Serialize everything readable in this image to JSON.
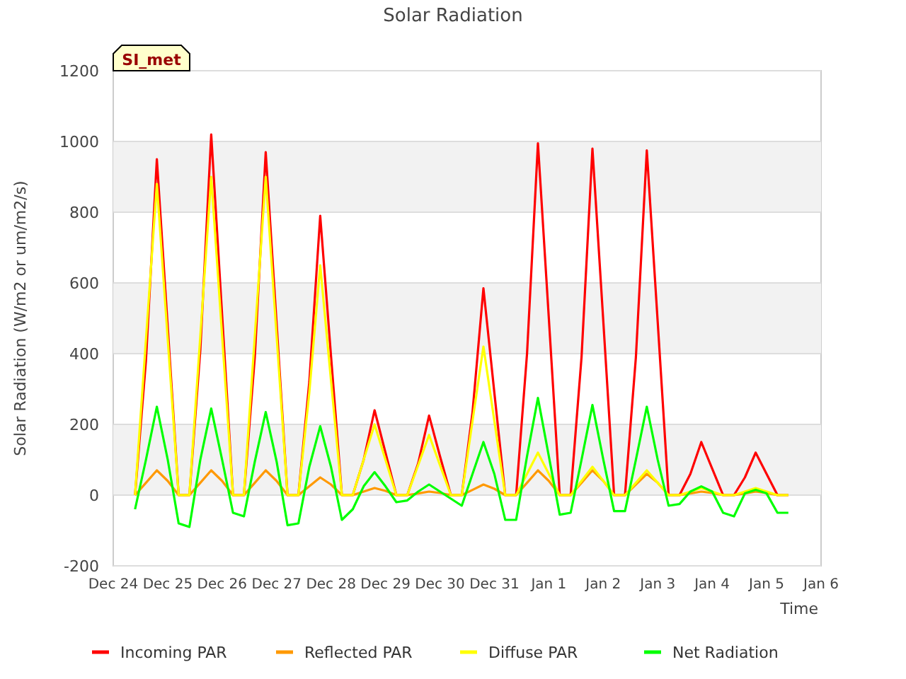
{
  "site_label": "SI_met",
  "chart_data": {
    "type": "line",
    "title": "Solar Radiation",
    "xlabel": "Time",
    "ylabel": "Solar Radiation (W/m2 or um/m2/s)",
    "categories": [
      "Dec 24",
      null,
      null,
      null,
      null,
      "Dec 25",
      null,
      null,
      null,
      null,
      "Dec 26",
      null,
      null,
      null,
      null,
      "Dec 27",
      null,
      null,
      null,
      null,
      "Dec 28",
      null,
      null,
      null,
      null,
      "Dec 29",
      null,
      null,
      null,
      null,
      "Dec 30",
      null,
      null,
      null,
      null,
      "Dec 31",
      null,
      null,
      null,
      null,
      "Jan 1",
      null,
      null,
      null,
      null,
      "Jan 2",
      null,
      null,
      null,
      null,
      "Jan 3",
      null,
      null,
      null,
      null,
      "Jan 4",
      null,
      null,
      null,
      null,
      "Jan 5",
      null,
      null,
      null,
      null,
      "Jan 6"
    ],
    "series": [
      {
        "name": "Incoming PAR",
        "color": "#ff0000",
        "values": [
          null,
          null,
          0,
          380,
          950,
          475,
          0,
          0,
          410,
          1020,
          510,
          0,
          0,
          390,
          970,
          485,
          0,
          0,
          320,
          790,
          395,
          0,
          0,
          100,
          240,
          120,
          0,
          0,
          90,
          225,
          110,
          0,
          0,
          235,
          585,
          290,
          0,
          0,
          400,
          995,
          500,
          0,
          0,
          390,
          980,
          490,
          0,
          0,
          390,
          975,
          490,
          0,
          0,
          60,
          150,
          75,
          0,
          0,
          50,
          120,
          60,
          0,
          0,
          null,
          null,
          null
        ]
      },
      {
        "name": "Reflected PAR",
        "color": "#ff9900",
        "values": [
          null,
          null,
          0,
          35,
          70,
          40,
          0,
          0,
          35,
          70,
          40,
          0,
          0,
          35,
          70,
          40,
          0,
          0,
          25,
          50,
          30,
          0,
          0,
          10,
          20,
          12,
          0,
          0,
          5,
          10,
          6,
          0,
          0,
          15,
          30,
          18,
          0,
          0,
          35,
          70,
          40,
          0,
          0,
          35,
          70,
          40,
          0,
          0,
          30,
          60,
          35,
          0,
          0,
          5,
          10,
          6,
          0,
          0,
          5,
          10,
          6,
          0,
          0,
          null,
          null,
          null
        ]
      },
      {
        "name": "Diffuse PAR",
        "color": "#ffff00",
        "values": [
          null,
          null,
          0,
          440,
          880,
          440,
          0,
          0,
          450,
          900,
          450,
          0,
          0,
          450,
          900,
          450,
          0,
          0,
          290,
          650,
          325,
          0,
          0,
          100,
          200,
          100,
          0,
          0,
          85,
          170,
          85,
          0,
          0,
          210,
          420,
          210,
          0,
          0,
          60,
          120,
          60,
          0,
          0,
          40,
          80,
          40,
          0,
          0,
          35,
          70,
          35,
          0,
          0,
          10,
          20,
          10,
          0,
          0,
          10,
          20,
          10,
          0,
          0,
          null,
          null,
          null
        ]
      },
      {
        "name": "Net Radiation",
        "color": "#00ff00",
        "values": [
          null,
          null,
          -40,
          100,
          250,
          100,
          -80,
          -90,
          100,
          245,
          100,
          -50,
          -60,
          95,
          235,
          95,
          -85,
          -80,
          80,
          195,
          80,
          -70,
          -40,
          25,
          65,
          25,
          -20,
          -15,
          10,
          30,
          10,
          -10,
          -30,
          60,
          150,
          60,
          -70,
          -70,
          110,
          275,
          110,
          -55,
          -50,
          100,
          255,
          100,
          -45,
          -45,
          100,
          250,
          100,
          -30,
          -25,
          10,
          25,
          10,
          -50,
          -60,
          5,
          15,
          5,
          -50,
          -50,
          null,
          null,
          null
        ]
      }
    ],
    "grid": true,
    "legend": "bottom",
    "ylim": [
      -200,
      1200
    ],
    "yticks": [
      -200,
      0,
      200,
      400,
      600,
      800,
      1000,
      1200
    ]
  }
}
